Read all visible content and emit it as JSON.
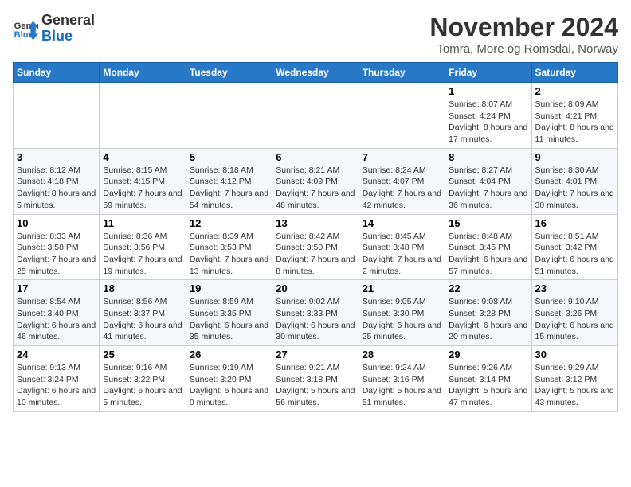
{
  "header": {
    "logo_line1": "General",
    "logo_line2": "Blue",
    "month_title": "November 2024",
    "location": "Tomra, More og Romsdal, Norway"
  },
  "calendar": {
    "days_of_week": [
      "Sunday",
      "Monday",
      "Tuesday",
      "Wednesday",
      "Thursday",
      "Friday",
      "Saturday"
    ],
    "weeks": [
      [
        {
          "day": "",
          "info": ""
        },
        {
          "day": "",
          "info": ""
        },
        {
          "day": "",
          "info": ""
        },
        {
          "day": "",
          "info": ""
        },
        {
          "day": "",
          "info": ""
        },
        {
          "day": "1",
          "info": "Sunrise: 8:07 AM\nSunset: 4:24 PM\nDaylight: 8 hours and 17 minutes."
        },
        {
          "day": "2",
          "info": "Sunrise: 8:09 AM\nSunset: 4:21 PM\nDaylight: 8 hours and 11 minutes."
        }
      ],
      [
        {
          "day": "3",
          "info": "Sunrise: 8:12 AM\nSunset: 4:18 PM\nDaylight: 8 hours and 5 minutes."
        },
        {
          "day": "4",
          "info": "Sunrise: 8:15 AM\nSunset: 4:15 PM\nDaylight: 7 hours and 59 minutes."
        },
        {
          "day": "5",
          "info": "Sunrise: 8:18 AM\nSunset: 4:12 PM\nDaylight: 7 hours and 54 minutes."
        },
        {
          "day": "6",
          "info": "Sunrise: 8:21 AM\nSunset: 4:09 PM\nDaylight: 7 hours and 48 minutes."
        },
        {
          "day": "7",
          "info": "Sunrise: 8:24 AM\nSunset: 4:07 PM\nDaylight: 7 hours and 42 minutes."
        },
        {
          "day": "8",
          "info": "Sunrise: 8:27 AM\nSunset: 4:04 PM\nDaylight: 7 hours and 36 minutes."
        },
        {
          "day": "9",
          "info": "Sunrise: 8:30 AM\nSunset: 4:01 PM\nDaylight: 7 hours and 30 minutes."
        }
      ],
      [
        {
          "day": "10",
          "info": "Sunrise: 8:33 AM\nSunset: 3:58 PM\nDaylight: 7 hours and 25 minutes."
        },
        {
          "day": "11",
          "info": "Sunrise: 8:36 AM\nSunset: 3:56 PM\nDaylight: 7 hours and 19 minutes."
        },
        {
          "day": "12",
          "info": "Sunrise: 8:39 AM\nSunset: 3:53 PM\nDaylight: 7 hours and 13 minutes."
        },
        {
          "day": "13",
          "info": "Sunrise: 8:42 AM\nSunset: 3:50 PM\nDaylight: 7 hours and 8 minutes."
        },
        {
          "day": "14",
          "info": "Sunrise: 8:45 AM\nSunset: 3:48 PM\nDaylight: 7 hours and 2 minutes."
        },
        {
          "day": "15",
          "info": "Sunrise: 8:48 AM\nSunset: 3:45 PM\nDaylight: 6 hours and 57 minutes."
        },
        {
          "day": "16",
          "info": "Sunrise: 8:51 AM\nSunset: 3:42 PM\nDaylight: 6 hours and 51 minutes."
        }
      ],
      [
        {
          "day": "17",
          "info": "Sunrise: 8:54 AM\nSunset: 3:40 PM\nDaylight: 6 hours and 46 minutes."
        },
        {
          "day": "18",
          "info": "Sunrise: 8:56 AM\nSunset: 3:37 PM\nDaylight: 6 hours and 41 minutes."
        },
        {
          "day": "19",
          "info": "Sunrise: 8:59 AM\nSunset: 3:35 PM\nDaylight: 6 hours and 35 minutes."
        },
        {
          "day": "20",
          "info": "Sunrise: 9:02 AM\nSunset: 3:33 PM\nDaylight: 6 hours and 30 minutes."
        },
        {
          "day": "21",
          "info": "Sunrise: 9:05 AM\nSunset: 3:30 PM\nDaylight: 6 hours and 25 minutes."
        },
        {
          "day": "22",
          "info": "Sunrise: 9:08 AM\nSunset: 3:28 PM\nDaylight: 6 hours and 20 minutes."
        },
        {
          "day": "23",
          "info": "Sunrise: 9:10 AM\nSunset: 3:26 PM\nDaylight: 6 hours and 15 minutes."
        }
      ],
      [
        {
          "day": "24",
          "info": "Sunrise: 9:13 AM\nSunset: 3:24 PM\nDaylight: 6 hours and 10 minutes."
        },
        {
          "day": "25",
          "info": "Sunrise: 9:16 AM\nSunset: 3:22 PM\nDaylight: 6 hours and 5 minutes."
        },
        {
          "day": "26",
          "info": "Sunrise: 9:19 AM\nSunset: 3:20 PM\nDaylight: 6 hours and 0 minutes."
        },
        {
          "day": "27",
          "info": "Sunrise: 9:21 AM\nSunset: 3:18 PM\nDaylight: 5 hours and 56 minutes."
        },
        {
          "day": "28",
          "info": "Sunrise: 9:24 AM\nSunset: 3:16 PM\nDaylight: 5 hours and 51 minutes."
        },
        {
          "day": "29",
          "info": "Sunrise: 9:26 AM\nSunset: 3:14 PM\nDaylight: 5 hours and 47 minutes."
        },
        {
          "day": "30",
          "info": "Sunrise: 9:29 AM\nSunset: 3:12 PM\nDaylight: 5 hours and 43 minutes."
        }
      ]
    ]
  }
}
